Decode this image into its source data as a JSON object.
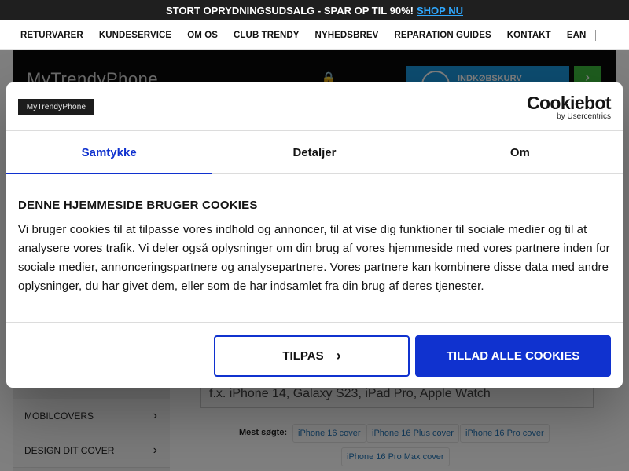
{
  "promo": {
    "text": "STORT OPRYDNINGSUDSALG - SPAR OP TIL 90%!",
    "link": "SHOP NU"
  },
  "nav": {
    "items": [
      "RETURVARER",
      "KUNDESERVICE",
      "OM OS",
      "CLUB TRENDY",
      "NYHEDSBREV",
      "REPARATION GUIDES",
      "KONTAKT",
      "EAN"
    ]
  },
  "header": {
    "logo": "MyTrendyPhone",
    "cart_label": "INDKØBSKURV",
    "go_arrow": "›"
  },
  "modal": {
    "logo_text": "MyTrendyPhone",
    "provider_main": "Cookiebot",
    "provider_sub": "by Usercentrics",
    "tabs": [
      "Samtykke",
      "Detaljer",
      "Om"
    ],
    "heading": "DENNE HJEMMESIDE BRUGER COOKIES",
    "body": "Vi bruger cookies til at tilpasse vores indhold og annoncer, til at vise dig funktioner til sociale medier og til at analysere vores trafik. Vi deler også oplysninger om din brug af vores hjemmeside med vores partnere inden for sociale medier, annonceringspartnere og analysepartnere. Vores partnere kan kombinere disse data med andre oplysninger, du har givet dem, eller som de har indsamlet fra din brug af deres tjenester.",
    "btn_customize": "TILPAS",
    "btn_allow": "TILLAD ALLE COOKIES"
  },
  "sidebar": {
    "items": [
      "MOBILCOVERS",
      "DESIGN DIT COVER"
    ]
  },
  "search": {
    "placeholder": "f.x. iPhone 14, Galaxy S23, iPad Pro, Apple Watch",
    "popular_label": "Mest søgte:",
    "chips": [
      "iPhone 16 cover",
      "iPhone 16 Plus cover",
      "iPhone 16 Pro cover",
      "iPhone 16 Pro Max cover"
    ]
  },
  "colors": {
    "accent": "#1032cf",
    "promo_bg": "#1f1f1f",
    "link": "#2fa8ff"
  }
}
